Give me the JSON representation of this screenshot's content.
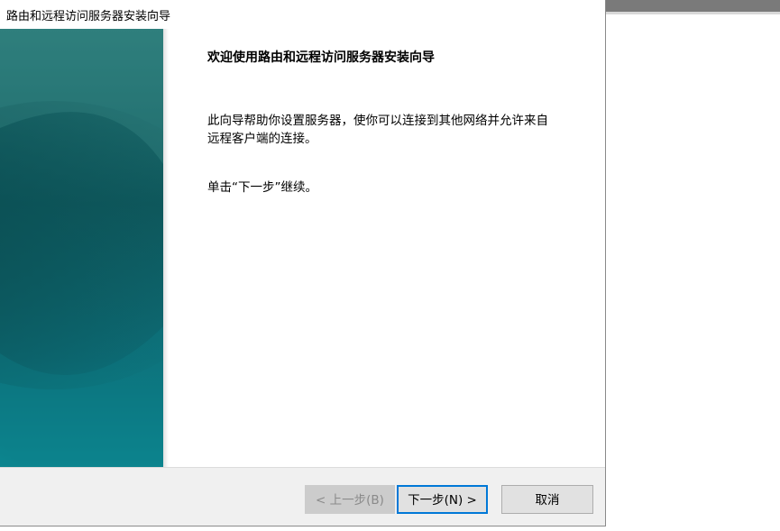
{
  "window": {
    "title": "路由和远程访问服务器安装向导"
  },
  "content": {
    "heading": "欢迎使用路由和远程访问服务器安装向导",
    "description": "此向导帮助你设置服务器，使你可以连接到其他网络并允许来自远程客户端的连接。",
    "instruction": "单击“下一步”继续。"
  },
  "buttons": {
    "back_label": "< 上一步(B)",
    "next_label": "下一步(N) >",
    "cancel_label": "取消"
  },
  "colors": {
    "accent": "#0078d7",
    "banner_dark": "#12595d",
    "banner_light": "#0e8590"
  }
}
